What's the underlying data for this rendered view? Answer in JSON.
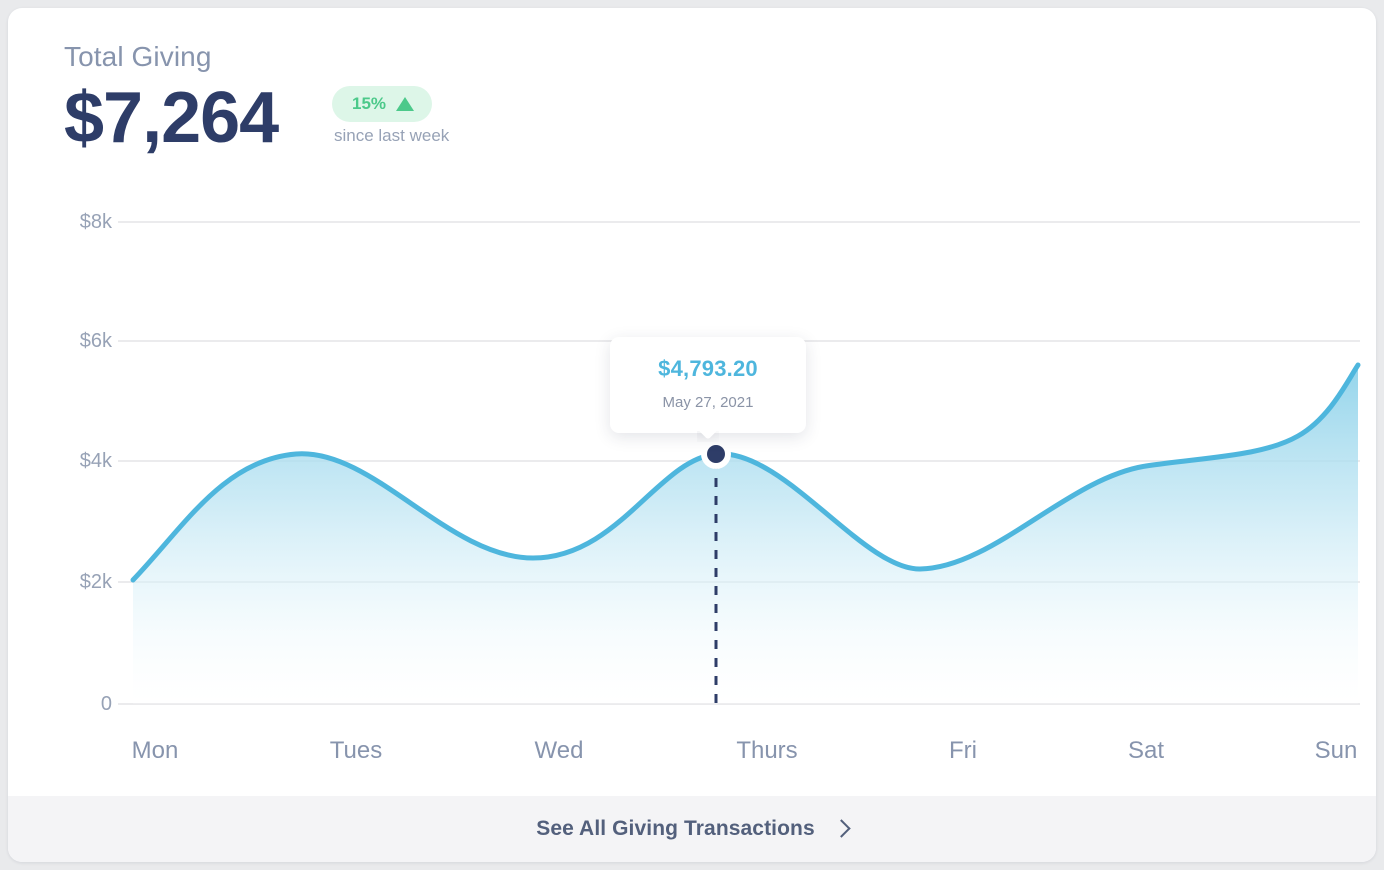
{
  "card": {
    "title": "Total Giving",
    "amount": "$7,264",
    "delta_percent": "15%",
    "delta_direction_icon": "triangle-up-icon",
    "delta_caption": "since last week",
    "accent_color": "#4eb6dd",
    "positive_color": "#4cc98a",
    "positive_bg_color": "#ddf6e8",
    "dark_color": "#2e3d68"
  },
  "tooltip": {
    "value": "$4,793.20",
    "date": "May 27, 2021"
  },
  "footer": {
    "link_label": "See All Giving Transactions",
    "chevron_icon": "chevron-right-icon"
  },
  "chart_data": {
    "type": "area",
    "title": "Total Giving",
    "xlabel": "",
    "ylabel": "",
    "categories": [
      "Mon",
      "Tues",
      "Wed",
      "Thurs",
      "Fri",
      "Sat",
      "Sun"
    ],
    "values": [
      2000,
      4100,
      2450,
      4100,
      2300,
      4050,
      5700
    ],
    "ytick_labels": [
      "$8k",
      "$6k",
      "$4k",
      "$2k",
      "0"
    ],
    "ytick_values": [
      8000,
      6000,
      4000,
      2000,
      0
    ],
    "ylim": [
      0,
      8000
    ],
    "grid": true,
    "legend": "none",
    "line_color": "#4eb6dd",
    "fill_gradient": [
      "#9fd9ec",
      "#f7fcfe"
    ],
    "highlight": {
      "category": "Thurs",
      "value": 4793.2,
      "label": "$4,793.20",
      "date": "May 27, 2021",
      "marker_color": "#2e3d68"
    }
  }
}
